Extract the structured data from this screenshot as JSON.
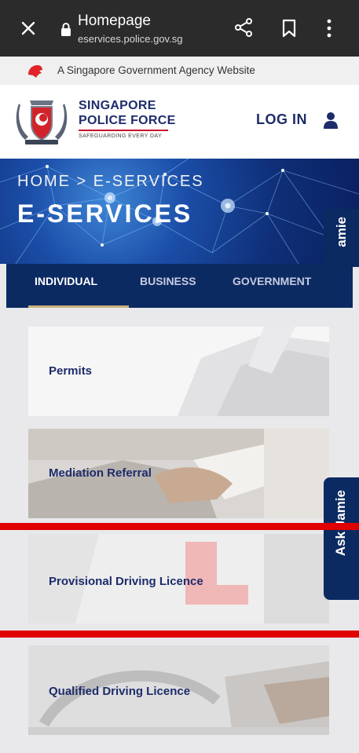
{
  "browser": {
    "title": "Homepage",
    "url": "eservices.police.gov.sg"
  },
  "gov_banner": {
    "text": "A Singapore Government Agency Website"
  },
  "header": {
    "brand_line1": "SINGAPORE",
    "brand_line2": "POLICE FORCE",
    "tagline": "SAFEGUARDING EVERY DAY",
    "login_label": "LOG IN"
  },
  "hero": {
    "breadcrumb": "HOME > E-SERVICES",
    "title": "E-SERVICES"
  },
  "tabs": [
    {
      "label": "INDIVIDUAL",
      "active": true
    },
    {
      "label": "BUSINESS",
      "active": false
    },
    {
      "label": "GOVERNMENT",
      "active": false
    }
  ],
  "ask_jamie": {
    "label_top": "amie",
    "label_side": "Ask Jamie"
  },
  "services": [
    {
      "label": "Permits"
    },
    {
      "label": "Mediation Referral"
    },
    {
      "label": "Provisional Driving Licence"
    },
    {
      "label": "Qualified Driving Licence"
    }
  ],
  "colors": {
    "brand_navy": "#1d2c6b",
    "tab_bar": "#0c2a62",
    "highlight_red": "#e00000",
    "accent_gold": "#c9b17a"
  }
}
